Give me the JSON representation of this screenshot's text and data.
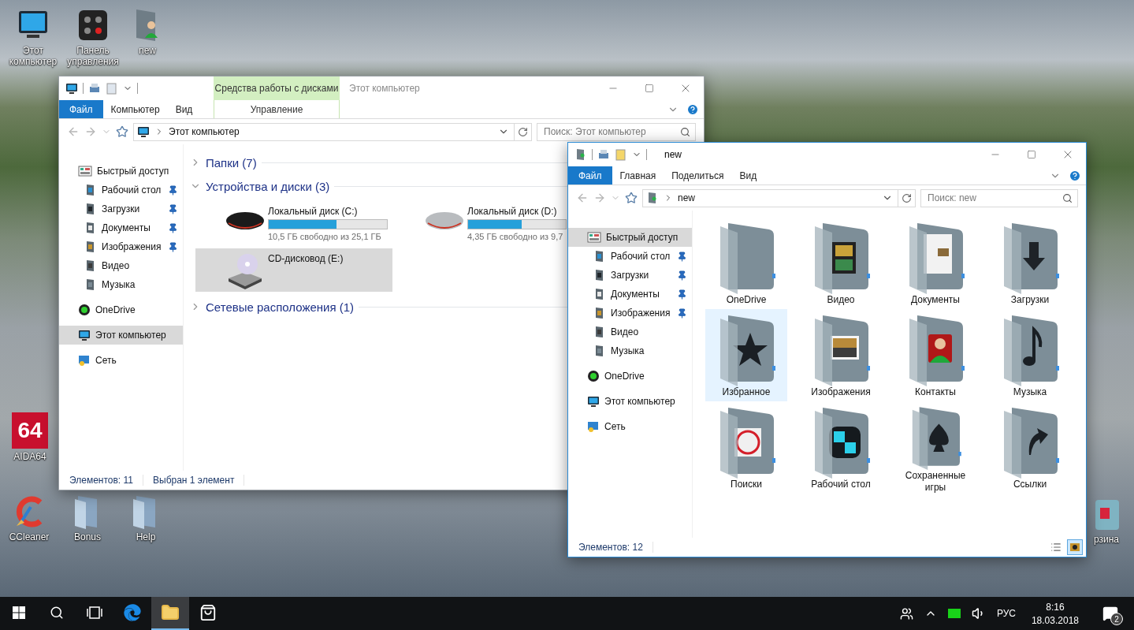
{
  "desktop": {
    "icons": [
      {
        "label": "Этот компьютер",
        "kind": "computer"
      },
      {
        "label": "Панель управления",
        "kind": "control-panel"
      },
      {
        "label": "new",
        "kind": "user-folder"
      },
      {
        "label": "AIDA64",
        "kind": "aida",
        "logo_text": "64"
      },
      {
        "label": "CCleaner",
        "kind": "ccleaner"
      },
      {
        "label": "Bonus",
        "kind": "folder"
      },
      {
        "label": "Help",
        "kind": "folder"
      },
      {
        "label": "рзина",
        "kind": "recycle-bin"
      }
    ]
  },
  "windows": [
    {
      "title": "Этот компьютер",
      "active": false,
      "kind": "computer",
      "context_tab": {
        "group": "Средства работы с дисками",
        "label": "Управление"
      },
      "ribbon_tabs": [
        {
          "label": "Файл",
          "kind": "file"
        },
        {
          "label": "Компьютер",
          "kind": "tab"
        },
        {
          "label": "Вид",
          "kind": "tab"
        }
      ],
      "address": "Этот компьютер",
      "search": {
        "placeholder": "Поиск: Этот компьютер"
      },
      "nav": [
        {
          "label": "Быстрый доступ",
          "kind": "quick-access",
          "selected": false,
          "children": [
            {
              "label": "Рабочий стол",
              "kind": "desktop",
              "pinned": true,
              "selected": false
            },
            {
              "label": "Загрузки",
              "kind": "downloads",
              "pinned": true,
              "selected": false
            },
            {
              "label": "Документы",
              "kind": "documents",
              "pinned": true,
              "selected": false
            },
            {
              "label": "Изображения",
              "kind": "pictures",
              "pinned": true,
              "selected": false
            },
            {
              "label": "Видео",
              "kind": "videos",
              "pinned": false,
              "selected": false
            },
            {
              "label": "Музыка",
              "kind": "music",
              "pinned": false,
              "selected": false
            }
          ]
        },
        {
          "label": "OneDrive",
          "kind": "onedrive",
          "selected": false
        },
        {
          "label": "Этот компьютер",
          "kind": "computer",
          "selected": true
        },
        {
          "label": "Сеть",
          "kind": "network",
          "selected": false
        }
      ],
      "content": {
        "kind": "drives",
        "groups": [
          {
            "title": "Папки (7)",
            "expanded": false
          },
          {
            "title": "Устройства и диски (3)",
            "expanded": true,
            "drives": [
              {
                "name": "Локальный диск (C:)",
                "kind": "hdd-dark",
                "level": 0.57,
                "free": "10,5 ГБ свободно из 25,1 ГБ",
                "selected": false
              },
              {
                "name": "Локальный диск (D:)",
                "kind": "hdd-silver",
                "level": 0.55,
                "free": "4,35 ГБ свободно из 9,7",
                "selected": false
              },
              {
                "name": "CD-дисковод (E:)",
                "kind": "cd",
                "selected": true
              }
            ]
          },
          {
            "title": "Сетевые расположения (1)",
            "expanded": false
          }
        ]
      },
      "status": [
        "Элементов: 11",
        "Выбран 1 элемент"
      ]
    },
    {
      "title": "new",
      "active": true,
      "kind": "user-folder",
      "ribbon_tabs": [
        {
          "label": "Файл",
          "kind": "file"
        },
        {
          "label": "Главная",
          "kind": "tab"
        },
        {
          "label": "Поделиться",
          "kind": "tab"
        },
        {
          "label": "Вид",
          "kind": "tab"
        }
      ],
      "address": "new",
      "search": {
        "placeholder": "Поиск: new"
      },
      "nav": [
        {
          "label": "Быстрый доступ",
          "kind": "quick-access",
          "selected": true,
          "children": [
            {
              "label": "Рабочий стол",
              "kind": "desktop",
              "pinned": true,
              "selected": false
            },
            {
              "label": "Загрузки",
              "kind": "downloads",
              "pinned": true,
              "selected": false
            },
            {
              "label": "Документы",
              "kind": "documents",
              "pinned": true,
              "selected": false
            },
            {
              "label": "Изображения",
              "kind": "pictures",
              "pinned": true,
              "selected": false
            },
            {
              "label": "Видео",
              "kind": "videos",
              "pinned": false,
              "selected": false
            },
            {
              "label": "Музыка",
              "kind": "music",
              "pinned": false,
              "selected": false
            }
          ]
        },
        {
          "label": "OneDrive",
          "kind": "onedrive",
          "selected": false
        },
        {
          "label": "Этот компьютер",
          "kind": "computer",
          "selected": false
        },
        {
          "label": "Сеть",
          "kind": "network",
          "selected": false
        }
      ],
      "content": {
        "kind": "folders",
        "items": [
          {
            "label": "OneDrive",
            "kind": "plain",
            "selected": false
          },
          {
            "label": "Видео",
            "kind": "film",
            "selected": false
          },
          {
            "label": "Документы",
            "kind": "document",
            "selected": false
          },
          {
            "label": "Загрузки",
            "kind": "download",
            "selected": false
          },
          {
            "label": "Избранное",
            "kind": "star",
            "selected": true
          },
          {
            "label": "Изображения",
            "kind": "picture",
            "selected": false
          },
          {
            "label": "Контакты",
            "kind": "contact",
            "selected": false
          },
          {
            "label": "Музыка",
            "kind": "music",
            "selected": false
          },
          {
            "label": "Поиски",
            "kind": "search",
            "selected": false
          },
          {
            "label": "Рабочий стол",
            "kind": "tiles",
            "selected": false
          },
          {
            "label": "Сохраненные игры",
            "kind": "spade",
            "selected": false
          },
          {
            "label": "Ссылки",
            "kind": "link",
            "selected": false
          }
        ]
      },
      "status": [
        "Элементов: 12"
      ],
      "views": [
        {
          "kind": "details",
          "selected": false
        },
        {
          "kind": "large-icons",
          "selected": true
        }
      ]
    }
  ],
  "taskbar": {
    "buttons": [
      {
        "kind": "start",
        "active": false
      },
      {
        "kind": "search",
        "active": false
      },
      {
        "kind": "task-view",
        "active": false
      },
      {
        "kind": "edge",
        "active": false
      },
      {
        "kind": "explorer",
        "active": true
      },
      {
        "kind": "store",
        "active": false
      }
    ],
    "tray": {
      "icons": [
        {
          "kind": "people"
        },
        {
          "kind": "chevron"
        },
        {
          "kind": "battery"
        },
        {
          "kind": "volume"
        }
      ],
      "language": "РУС",
      "time": "8:16",
      "date": "18.03.2018",
      "notifications": "2"
    }
  }
}
